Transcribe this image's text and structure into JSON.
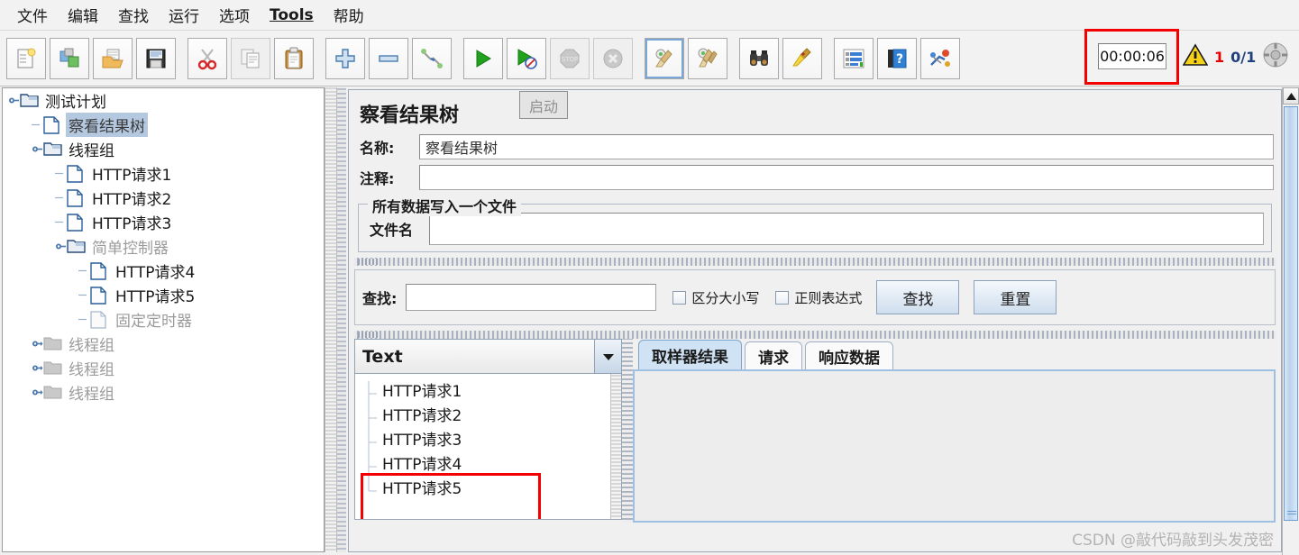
{
  "menu": {
    "items": [
      {
        "label": "文件",
        "bold": false
      },
      {
        "label": "编辑",
        "bold": false
      },
      {
        "label": "查找",
        "bold": false
      },
      {
        "label": "运行",
        "bold": false
      },
      {
        "label": "选项",
        "bold": false
      },
      {
        "label": "Tools",
        "bold": true
      },
      {
        "label": "帮助",
        "bold": false
      }
    ]
  },
  "toolbar": {
    "buttons": [
      {
        "name": "new-test-plan-icon",
        "enabled": true
      },
      {
        "name": "templates-icon",
        "enabled": true
      },
      {
        "name": "open-icon",
        "enabled": true
      },
      {
        "name": "save-icon",
        "enabled": true
      },
      {
        "name": "cut-icon",
        "enabled": true
      },
      {
        "name": "copy-icon",
        "enabled": false
      },
      {
        "name": "paste-icon",
        "enabled": true
      },
      {
        "name": "expand-add-icon",
        "enabled": true
      },
      {
        "name": "collapse-remove-icon",
        "enabled": true
      },
      {
        "name": "toggle-icon",
        "enabled": true
      },
      {
        "name": "start-icon",
        "enabled": true
      },
      {
        "name": "start-no-pauses-icon",
        "enabled": true
      },
      {
        "name": "stop-icon",
        "enabled": false
      },
      {
        "name": "shutdown-icon",
        "enabled": false
      },
      {
        "name": "clear-icon",
        "enabled": true
      },
      {
        "name": "clear-all-icon",
        "enabled": true
      },
      {
        "name": "search-binoculars-icon",
        "enabled": true
      },
      {
        "name": "reset-search-broom-icon",
        "enabled": true
      },
      {
        "name": "function-helper-icon",
        "enabled": true
      },
      {
        "name": "help-icon",
        "enabled": true
      },
      {
        "name": "undo-redo-icon",
        "enabled": true
      }
    ]
  },
  "status": {
    "timer": "00:00:06",
    "warning_icon": "warning-triangle-icon",
    "error_count": "1",
    "thread_count": "0/1",
    "remote_icon": "remote-engine-icon",
    "annotation_color": "#f40000"
  },
  "tooltip": {
    "text": "启动"
  },
  "tree": {
    "nodes": [
      {
        "label": "测试计划",
        "indent": 0,
        "icon": "folder-icon",
        "handle": "expanded",
        "state": "normal"
      },
      {
        "label": "察看结果树",
        "indent": 1,
        "icon": "leaf-icon",
        "handle": "none",
        "state": "selected"
      },
      {
        "label": "线程组",
        "indent": 1,
        "icon": "folder-icon",
        "handle": "expanded",
        "state": "normal"
      },
      {
        "label": "HTTP请求1",
        "indent": 2,
        "icon": "leaf-icon",
        "handle": "none",
        "state": "normal"
      },
      {
        "label": "HTTP请求2",
        "indent": 2,
        "icon": "leaf-icon",
        "handle": "none",
        "state": "normal"
      },
      {
        "label": "HTTP请求3",
        "indent": 2,
        "icon": "leaf-icon",
        "handle": "none",
        "state": "normal"
      },
      {
        "label": "简单控制器",
        "indent": 2,
        "icon": "folder-icon",
        "handle": "expanded",
        "state": "dim"
      },
      {
        "label": "HTTP请求4",
        "indent": 3,
        "icon": "leaf-icon",
        "handle": "none",
        "state": "normal"
      },
      {
        "label": "HTTP请求5",
        "indent": 3,
        "icon": "leaf-icon",
        "handle": "none",
        "state": "normal"
      },
      {
        "label": "固定定时器",
        "indent": 3,
        "icon": "leaf-icon",
        "handle": "none",
        "state": "dim"
      },
      {
        "label": "线程组",
        "indent": 1,
        "icon": "folder-dim-icon",
        "handle": "collapsed",
        "state": "dim"
      },
      {
        "label": "线程组",
        "indent": 1,
        "icon": "folder-dim-icon",
        "handle": "collapsed",
        "state": "dim"
      },
      {
        "label": "线程组",
        "indent": 1,
        "icon": "folder-dim-icon",
        "handle": "collapsed",
        "state": "dim"
      }
    ]
  },
  "panel": {
    "title": "察看结果树",
    "name_label": "名称:",
    "name_value": "察看结果树",
    "comment_label": "注释:",
    "comment_value": "",
    "file_group_title": "所有数据写入一个文件",
    "filename_label": "文件名",
    "filename_value": ""
  },
  "search": {
    "label": "查找:",
    "value": "",
    "case_sensitive_label": "区分大小写",
    "case_sensitive_checked": false,
    "regex_label": "正则表达式",
    "regex_checked": false,
    "find_button": "查找",
    "reset_button": "重置"
  },
  "results": {
    "renderer_selected": "Text",
    "items": [
      {
        "label": "HTTP请求1",
        "highlighted": false
      },
      {
        "label": "HTTP请求2",
        "highlighted": false
      },
      {
        "label": "HTTP请求3",
        "highlighted": false
      },
      {
        "label": "HTTP请求4",
        "highlighted": true
      },
      {
        "label": "HTTP请求5",
        "highlighted": true
      }
    ],
    "annotation_color": "#f40000"
  },
  "detail_tabs": {
    "tabs": [
      {
        "label": "取样器结果",
        "active": true
      },
      {
        "label": "请求",
        "active": false
      },
      {
        "label": "响应数据",
        "active": false
      }
    ],
    "body_text": ""
  },
  "watermark": {
    "text": "CSDN @敲代码敲到头发茂密"
  }
}
